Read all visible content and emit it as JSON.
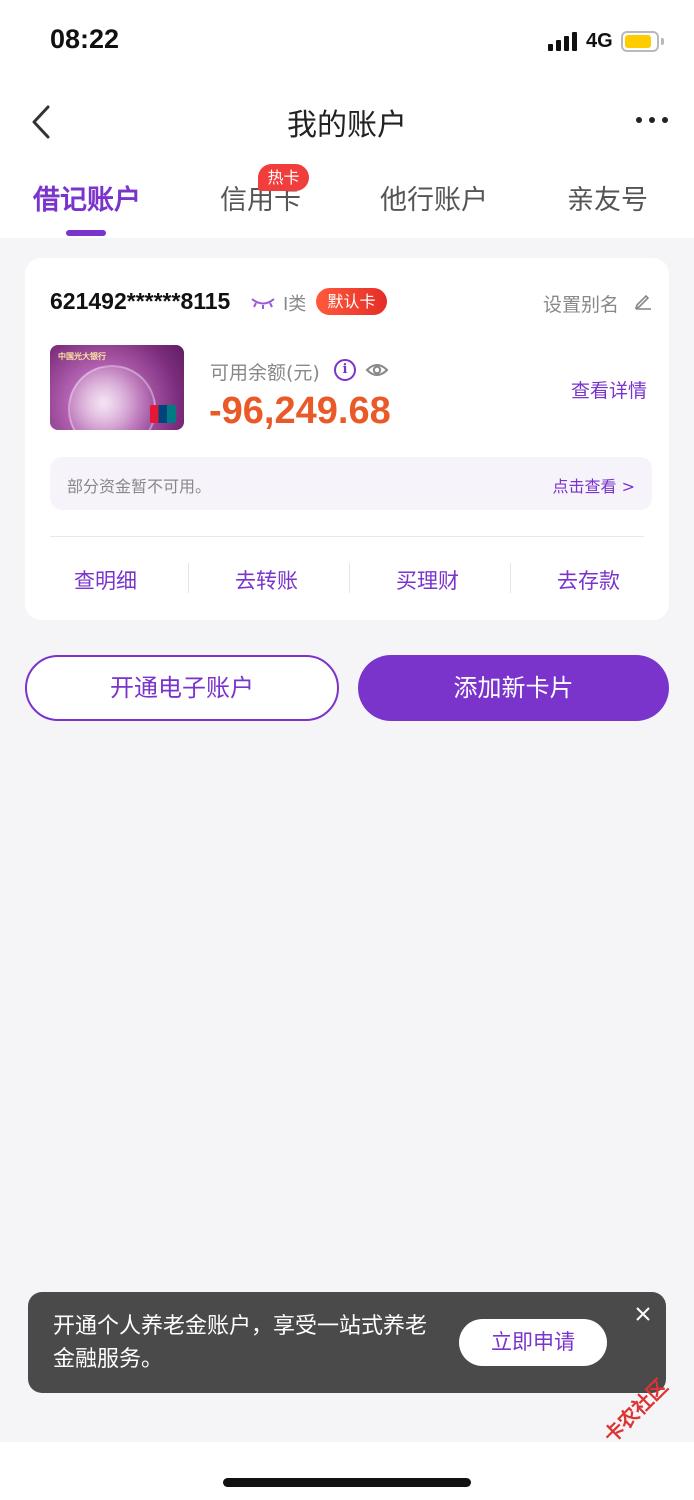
{
  "status_bar": {
    "time": "08:22",
    "network": "4G"
  },
  "nav": {
    "title": "我的账户"
  },
  "tabs": [
    {
      "label": "借记账户",
      "active": true
    },
    {
      "label": "信用卡",
      "badge": "热卡"
    },
    {
      "label": "他行账户"
    },
    {
      "label": "亲友号"
    }
  ],
  "account": {
    "number": "621492******8115",
    "class_label": "I类",
    "default_badge": "默认卡",
    "alias_label": "设置别名",
    "card_bank_name": "中国光大银行",
    "balance_label": "可用余额(元)",
    "info_glyph": "i",
    "balance": "-96,249.68",
    "detail_link": "查看详情",
    "notice_text": "部分资金暂不可用。",
    "notice_link": "点击查看 >"
  },
  "actions": [
    "查明细",
    "去转账",
    "买理财",
    "去存款"
  ],
  "buttons": {
    "open_e_account": "开通电子账户",
    "add_card": "添加新卡片"
  },
  "toast": {
    "message": "开通个人养老金账户，享受一站式养老金融服务。",
    "apply_label": "立即申请"
  },
  "watermark": "卡农社区",
  "colors": {
    "accent": "#7a34cc",
    "balance": "#e95a28",
    "badge": "#f23d3d"
  }
}
